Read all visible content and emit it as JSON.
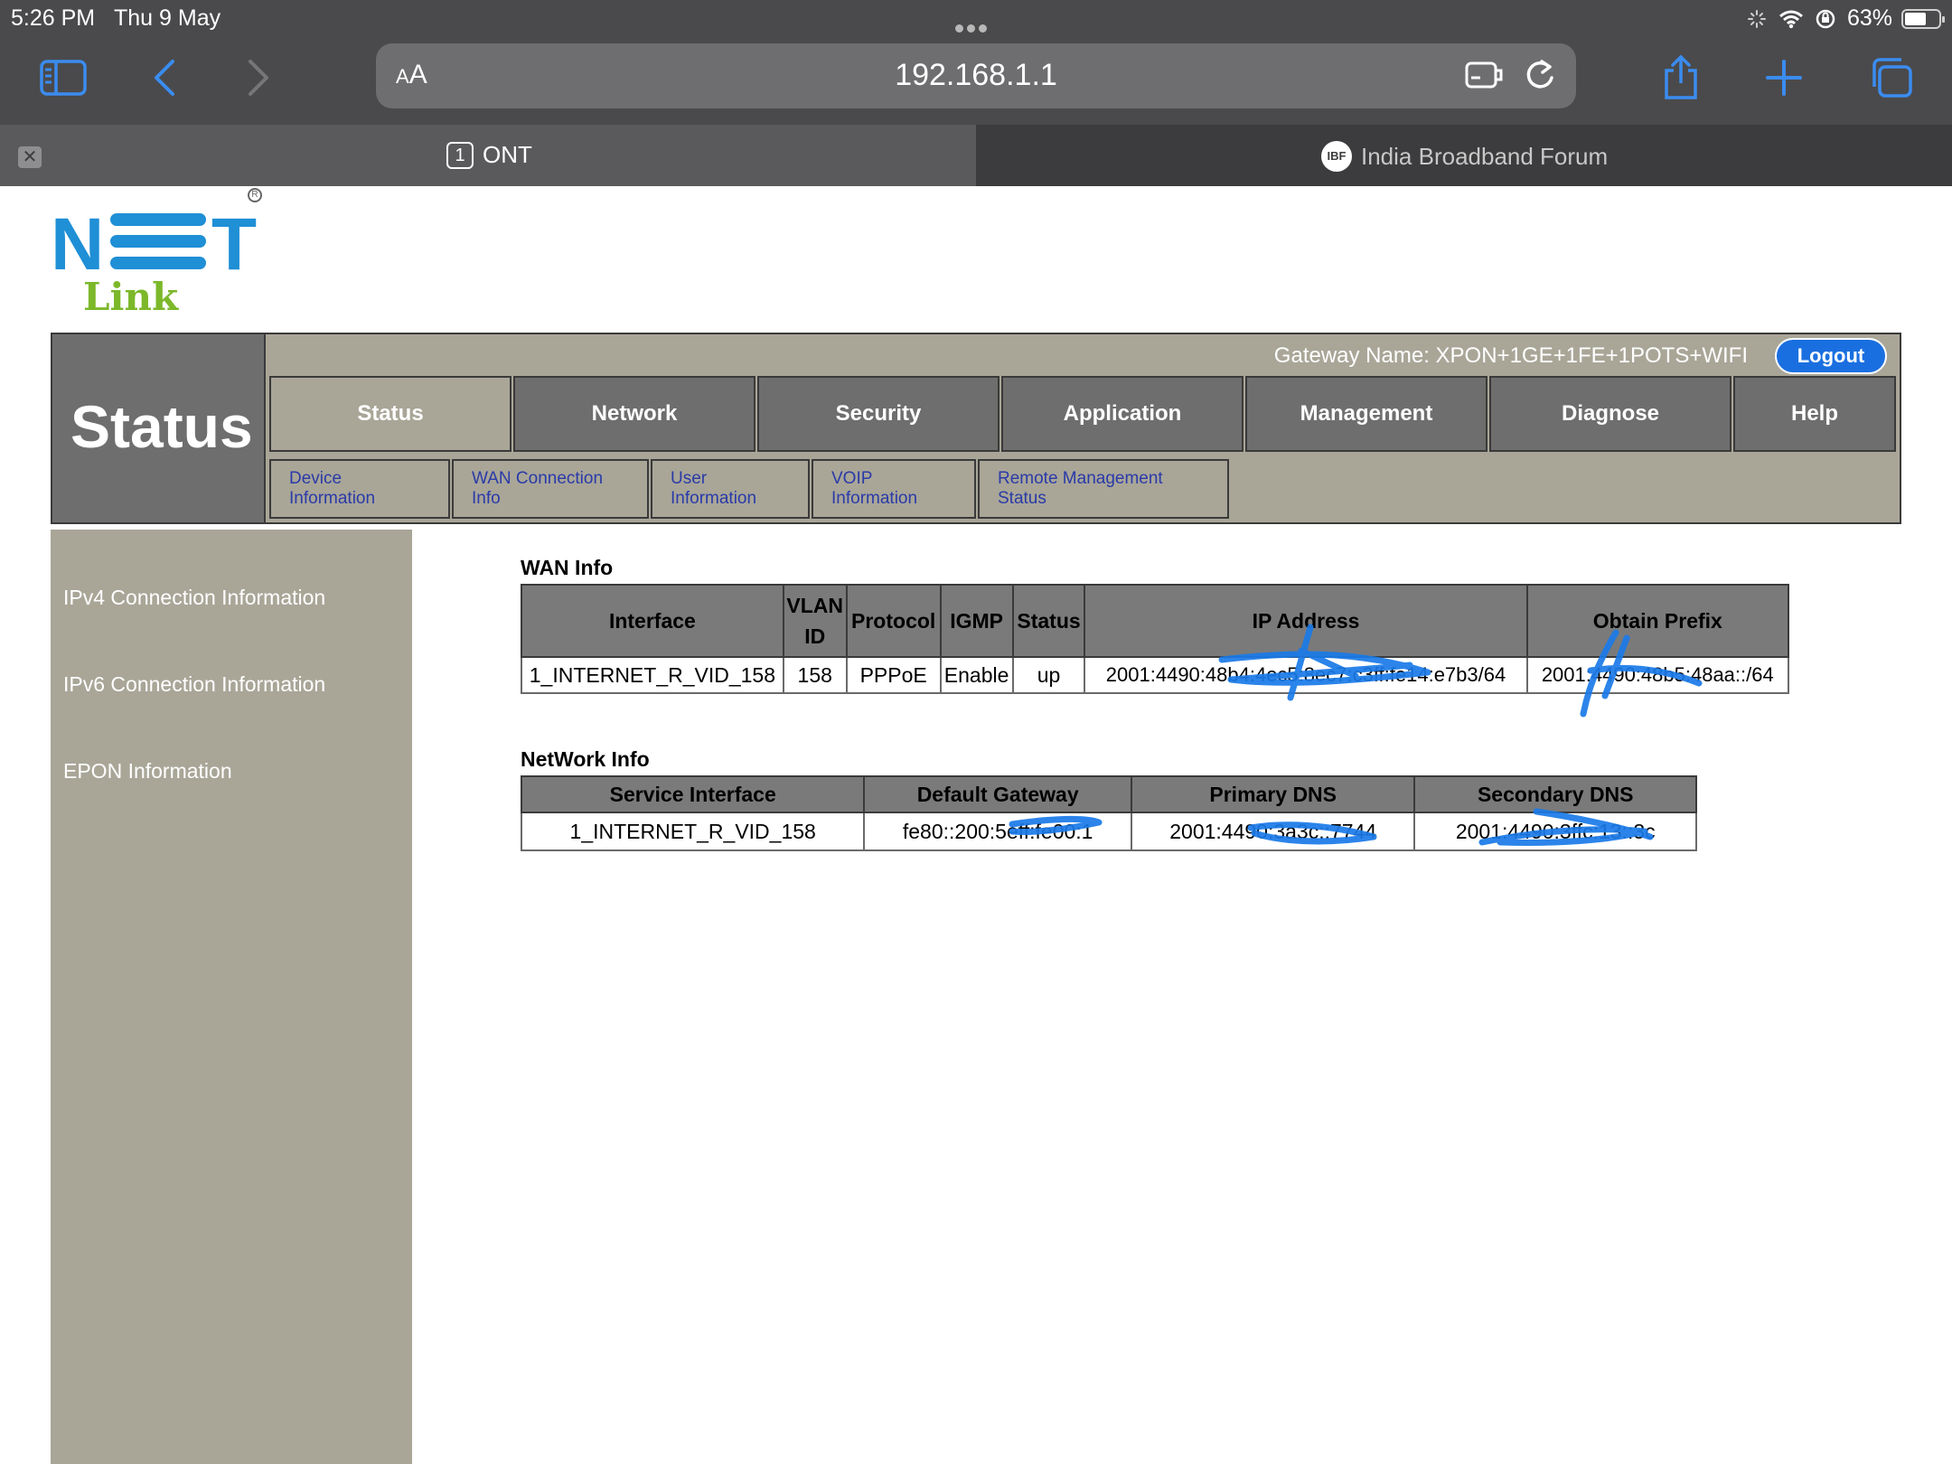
{
  "device_status": {
    "time": "5:26 PM",
    "date": "Thu 9 May",
    "battery": "63%"
  },
  "browser": {
    "url": "192.168.1.1",
    "text_size_label": "AA",
    "tabs": [
      {
        "number": "1",
        "title": "ONT"
      },
      {
        "favicon": "IBF",
        "title": "India Broadband Forum"
      }
    ]
  },
  "logo": {
    "brand_top": "NET",
    "brand_bottom": "Link"
  },
  "header": {
    "section_title": "Status",
    "gateway_name": "Gateway Name: XPON+1GE+1FE+1POTS+WIFI",
    "logout_label": "Logout"
  },
  "menu": [
    "Status",
    "Network",
    "Security",
    "Application",
    "Management",
    "Diagnose",
    "Help"
  ],
  "submenu": [
    "Device Information",
    "WAN Connection Info",
    "User Information",
    "VOIP Information",
    "Remote Management Status"
  ],
  "sidebar": [
    "IPv4 Connection Information",
    "IPv6 Connection Information",
    "EPON Information"
  ],
  "wan_info": {
    "title": "WAN Info",
    "headers": [
      "Interface",
      "VLAN ID",
      "Protocol",
      "IGMP",
      "Status",
      "IP Address",
      "Obtain Prefix"
    ],
    "rows": [
      [
        "1_INTERNET_R_VID_158",
        "158",
        "PPPoE",
        "Enable",
        "up",
        "2001:4490:48b4:4ec5:8ec7:c3ff:fe14:e7b3/64",
        "2001:4490:48b5:48aa::/64"
      ]
    ]
  },
  "network_info": {
    "title": "NetWork Info",
    "headers": [
      "Service Interface",
      "Default Gateway",
      "Primary DNS",
      "Secondary DNS"
    ],
    "rows": [
      [
        "1_INTERNET_R_VID_158",
        "fe80::200:5eff:fe00:1",
        "2001:4490:3a3c::7744",
        "2001:4490:3ffc:13::3c"
      ]
    ]
  },
  "colors": {
    "chrome_bg": "#4a4a4c",
    "panel_beige": "#a9a698",
    "menu_grey": "#6e6e6e",
    "link_blue": "#2a3aa8",
    "logout_blue": "#1a6fe0",
    "scribble_blue": "#1a7ae8"
  }
}
